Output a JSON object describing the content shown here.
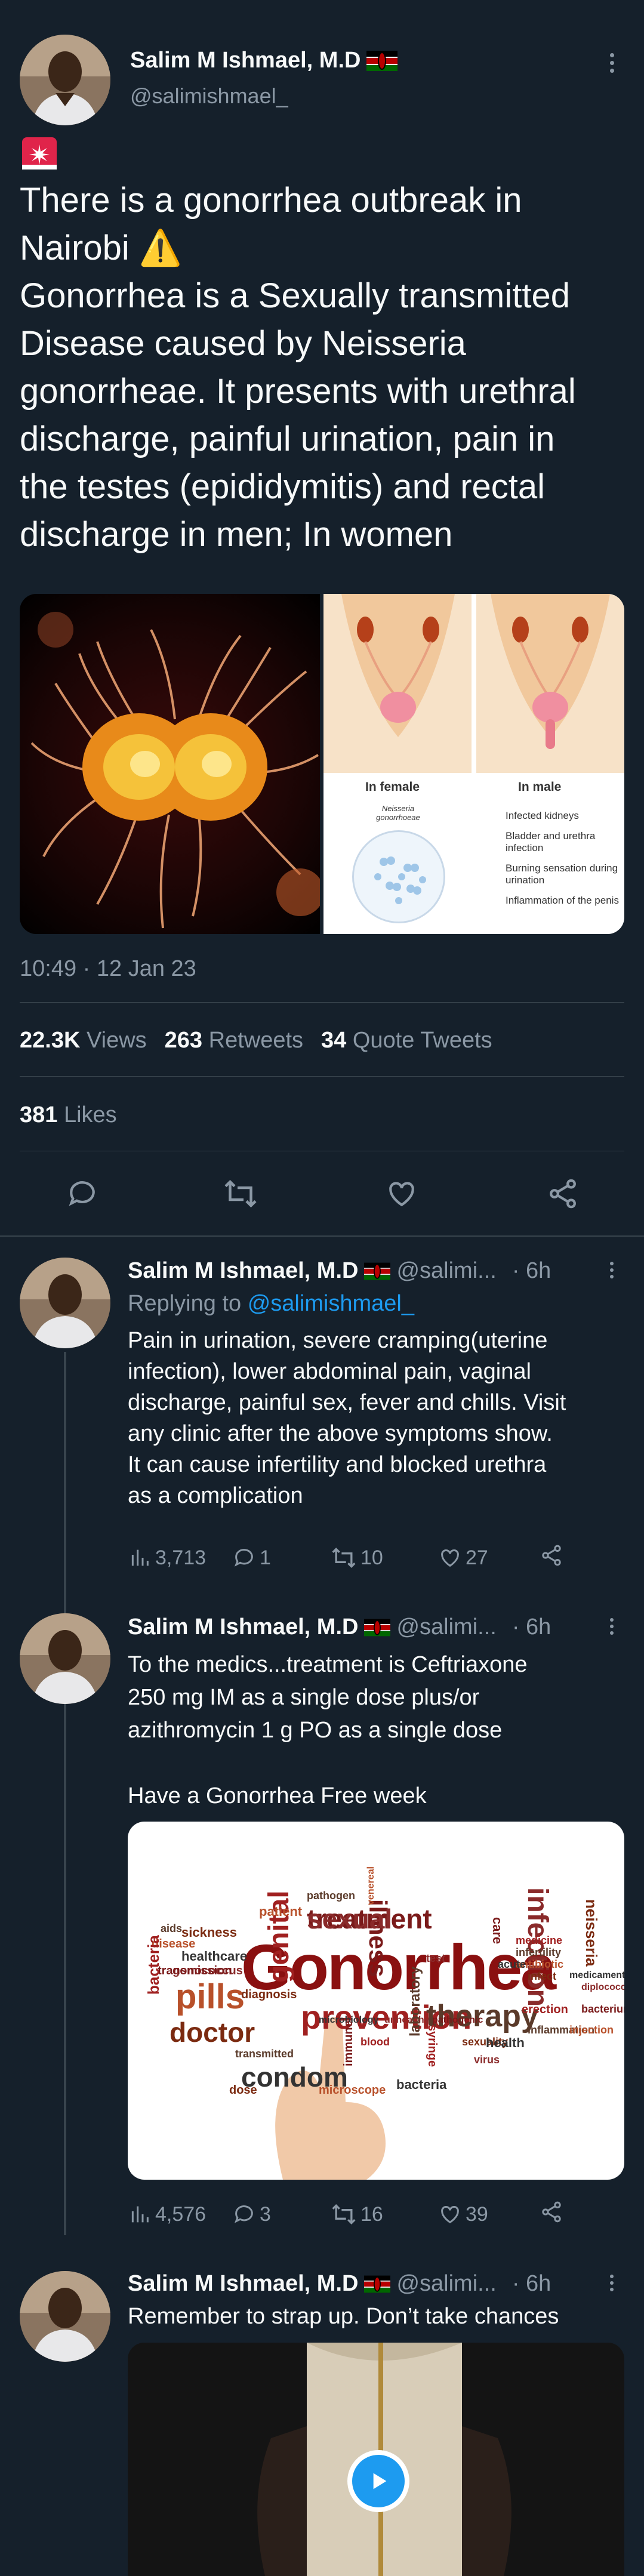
{
  "main_tweet": {
    "author_name": "Salim M Ishmael, M.D",
    "handle": "@salimishmael_",
    "siren_emoji": "🚨",
    "line1": "There is a gonorrhea outbreak in",
    "line2": "Nairobi ⚠️",
    "body_lines": [
      "Gonorrhea is a Sexually transmitted",
      "Disease caused by Neisseria",
      "gonorrheae. It presents with urethral",
      "discharge, painful urination, pain in",
      "the testes (epididymitis) and rectal",
      "discharge in men; In women"
    ],
    "image_right": {
      "female_label": "In female",
      "male_label": "In male",
      "neisseria_label": "Neisseria gonorrhoeae",
      "male_symptoms": [
        "Infected kidneys",
        "Bladder and urethra infection",
        "Burning sensation during urination",
        "Inflammation of the penis"
      ]
    },
    "timestamp": "10:49 · 12 Jan 23",
    "views_count": "22.3K",
    "views_label": "Views",
    "retweets_count": "263",
    "retweets_label": "Retweets",
    "quotes_count": "34",
    "quotes_label": "Quote Tweets",
    "likes_count": "381",
    "likes_label": "Likes"
  },
  "replies": [
    {
      "author_name": "Salim M Ishmael, M.D",
      "handle": "@salimi...",
      "time": "· 6h",
      "replying_prefix": "Replying to",
      "replying_handle": "@salimishmael_",
      "text_lines": [
        "Pain in urination, severe cramping(uterine",
        "infection), lower abdominal pain, vaginal",
        "discharge, painful sex, fever and chills. Visit",
        "any clinic after the above symptoms show.",
        "It can cause infertility and blocked urethra",
        "as a complication"
      ],
      "views": "3,713",
      "replies": "1",
      "retweets": "10",
      "likes": "27"
    },
    {
      "author_name": "Salim M Ishmael, M.D",
      "handle": "@salimi...",
      "time": "· 6h",
      "text_lines": [
        "To the medics...treatment is Ceftriaxone",
        "250 mg IM as a single dose plus/or",
        "azithromycin 1 g PO as a single dose",
        "",
        "Have a Gonorrhea Free week"
      ],
      "word_cloud": {
        "main": "Gonorrhea",
        "words": [
          "treatment",
          "prevention",
          "therapy",
          "pills",
          "doctor",
          "condom",
          "infection",
          "illness",
          "genital",
          "aids",
          "disease",
          "sickness",
          "healthcare",
          "gonococcus",
          "transmission",
          "bacteria",
          "pathogen",
          "venereal",
          "diagnosis",
          "microbiology",
          "unhealthy",
          "pathogenic",
          "medicine",
          "infertility",
          "antibiotic",
          "infect",
          "medicament",
          "diplococci",
          "bacterium",
          "erection",
          "inflammation",
          "injection",
          "sexuality",
          "health",
          "virus",
          "immune",
          "blood",
          "transmitted",
          "patient",
          "neisseria",
          "acute",
          "test",
          "care",
          "syringe",
          "laboratory",
          "microscope",
          "dose",
          "bacteria",
          "sexual"
        ]
      },
      "views": "4,576",
      "replies": "3",
      "retweets": "16",
      "likes": "39"
    },
    {
      "author_name": "Salim M Ishmael, M.D",
      "handle": "@salimi...",
      "time": "· 6h",
      "text_lines": [
        "Remember to strap up. Don’t take chances"
      ]
    }
  ]
}
